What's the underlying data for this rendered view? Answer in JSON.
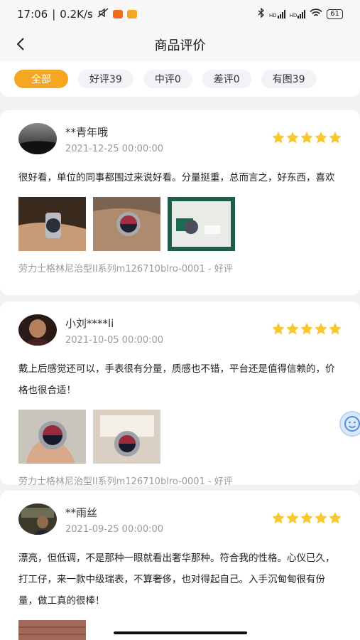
{
  "status_bar": {
    "time": "17:06",
    "net_speed": "0.2K/s",
    "separator": "|",
    "battery": "61",
    "hd1": "HD",
    "hd2": "HD"
  },
  "nav": {
    "title": "商品评价"
  },
  "filters": [
    {
      "label": "全部",
      "active": true
    },
    {
      "label": "好评39",
      "active": false
    },
    {
      "label": "中评0",
      "active": false
    },
    {
      "label": "差评0",
      "active": false
    },
    {
      "label": "有图39",
      "active": false
    }
  ],
  "reviews": [
    {
      "user": "**青年哦",
      "date": "2021-12-25 00:00:00",
      "rating": 5,
      "text": "很好看，单位的同事都围过来说好看。分量挺重，总而言之，好东西，喜欢",
      "photo_count": 3,
      "sku": "劳力士格林尼治型II系列m126710blro-0001 - 好评"
    },
    {
      "user": "小刘****li",
      "date": "2021-10-05 00:00:00",
      "rating": 5,
      "text": "戴上后感觉还可以，手表很有分量，质感也不错，平台还是值得信赖的，价格也很合适！",
      "photo_count": 2,
      "sku": "劳力士格林尼治型II系列m126710blro-0001 - 好评"
    },
    {
      "user": "**雨丝",
      "date": "2021-09-25 00:00:00",
      "rating": 5,
      "text": "漂亮，但低调，不是那种一眼就看出奢华那种。符合我的性格。心仪已久，打工仔，来一款中级瑞表，不算奢侈，也对得起自己。入手沉甸甸很有份量，做工真的很棒！",
      "photo_count": 1
    }
  ],
  "colors": {
    "accent": "#f5a623",
    "star": "#f7c82f",
    "muted": "#9a9a9a"
  }
}
